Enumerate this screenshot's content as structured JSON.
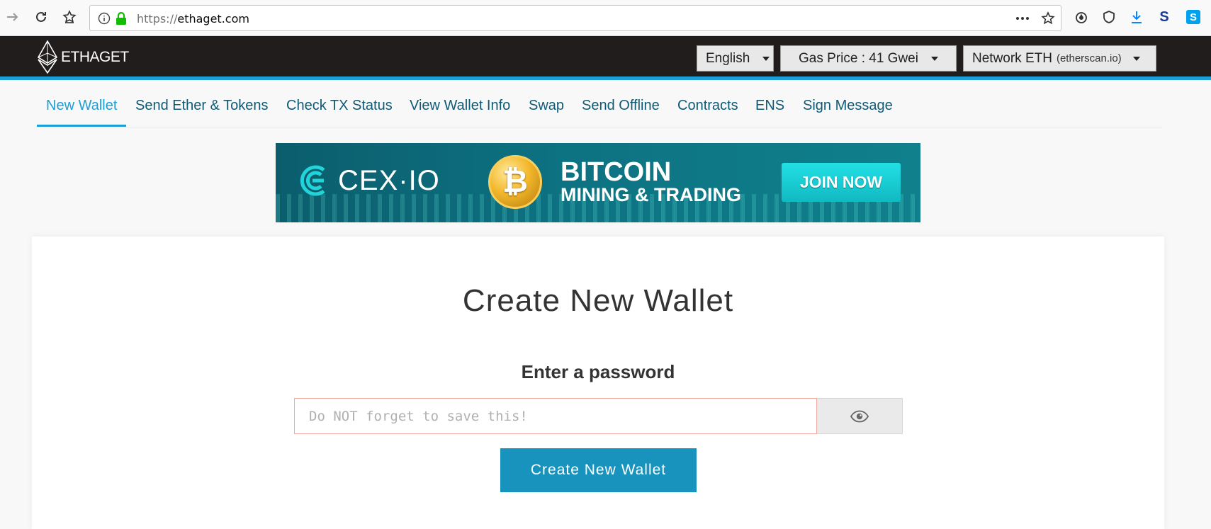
{
  "browser": {
    "url_protocol": "https://",
    "url_host": "ethaget.com"
  },
  "header": {
    "logo_text": "ETHAGET",
    "language": "English",
    "gas_price": "Gas Price : 41 Gwei",
    "network": "Network ETH",
    "network_provider": "(etherscan.io)"
  },
  "tabs": [
    {
      "label": "New Wallet",
      "active": true
    },
    {
      "label": "Send Ether & Tokens"
    },
    {
      "label": "Check TX Status"
    },
    {
      "label": "View Wallet Info"
    },
    {
      "label": "Swap"
    },
    {
      "label": "Send Offline"
    },
    {
      "label": "Contracts"
    },
    {
      "label": "ENS"
    },
    {
      "label": "Sign Message"
    }
  ],
  "banner": {
    "brand": "CEX·IO",
    "title": "BITCOIN",
    "subtitle": "MINING & TRADING",
    "cta": "JOIN NOW"
  },
  "main": {
    "title": "Create New Wallet",
    "password_label": "Enter a password",
    "password_placeholder": "Do NOT forget to save this!",
    "password_value": "",
    "create_button": "Create New Wallet"
  },
  "colors": {
    "accent": "#1c9ed6",
    "header_bg": "#211d1d",
    "button": "#1893bd",
    "input_border": "#f1a9a0"
  }
}
